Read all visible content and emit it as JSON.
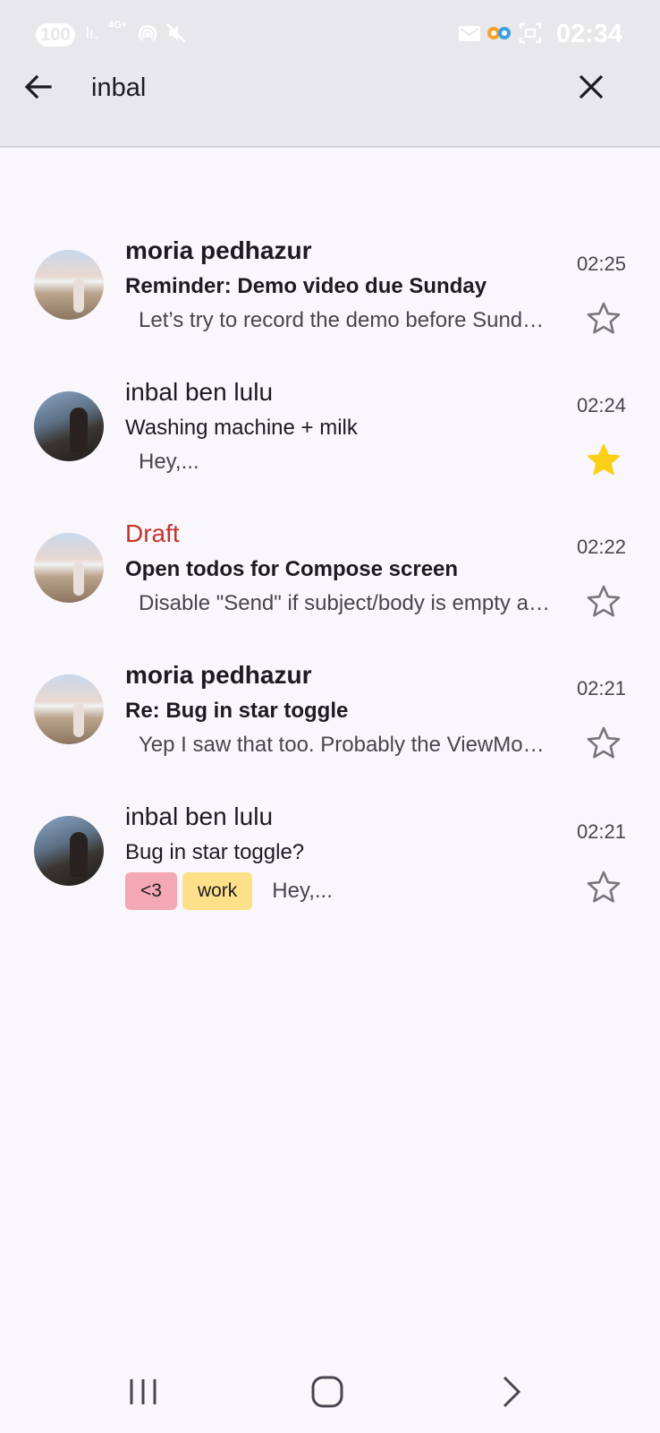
{
  "status_bar": {
    "battery": "100",
    "network": "4G+",
    "time": "02:34"
  },
  "search": {
    "query": "inbal",
    "back_icon": "arrow-left-icon",
    "clear_icon": "close-icon"
  },
  "emails": [
    {
      "sender": "moria pedhazur",
      "subject": "Reminder: Demo video due Sunday",
      "preview": "Let’s try to record the demo before Sunday so we have time to edit it.",
      "time": "02:25",
      "starred": false,
      "unread": true,
      "draft": false,
      "avatar": "beach"
    },
    {
      "sender": "inbal ben lulu",
      "subject": "Washing machine + milk",
      "preview": "Hey,...",
      "time": "02:24",
      "starred": true,
      "unread": false,
      "draft": false,
      "avatar": "city"
    },
    {
      "sender": "Draft",
      "subject": "Open todos for Compose screen",
      "preview": "Disable \"Send\" if subject/body is empty and show a warning.",
      "time": "02:22",
      "starred": false,
      "unread": true,
      "draft": true,
      "avatar": "beach"
    },
    {
      "sender": "moria pedhazur",
      "subject": "Re: Bug in star toggle",
      "preview": "Yep I saw that too. Probably the ViewModel is not updating the state.",
      "time": "02:21",
      "starred": false,
      "unread": true,
      "draft": false,
      "avatar": "beach"
    },
    {
      "sender": "inbal ben lulu",
      "subject": "Bug in star toggle?",
      "preview": "Hey,...",
      "time": "02:21",
      "starred": false,
      "unread": false,
      "draft": false,
      "avatar": "city",
      "labels": [
        {
          "text": "<3",
          "color": "#f4a7b4"
        },
        {
          "text": "work",
          "color": "#fde08a"
        }
      ]
    }
  ],
  "colors": {
    "star_filled": "#fdd017",
    "star_outline": "#79747e",
    "draft": "#c4342a",
    "top_bar": "#e8e7ec",
    "background": "#f9f6fc"
  },
  "nav_bar": {
    "recents_icon": "recents-icon",
    "home_icon": "home-icon",
    "back_icon": "back-chevron-icon"
  }
}
